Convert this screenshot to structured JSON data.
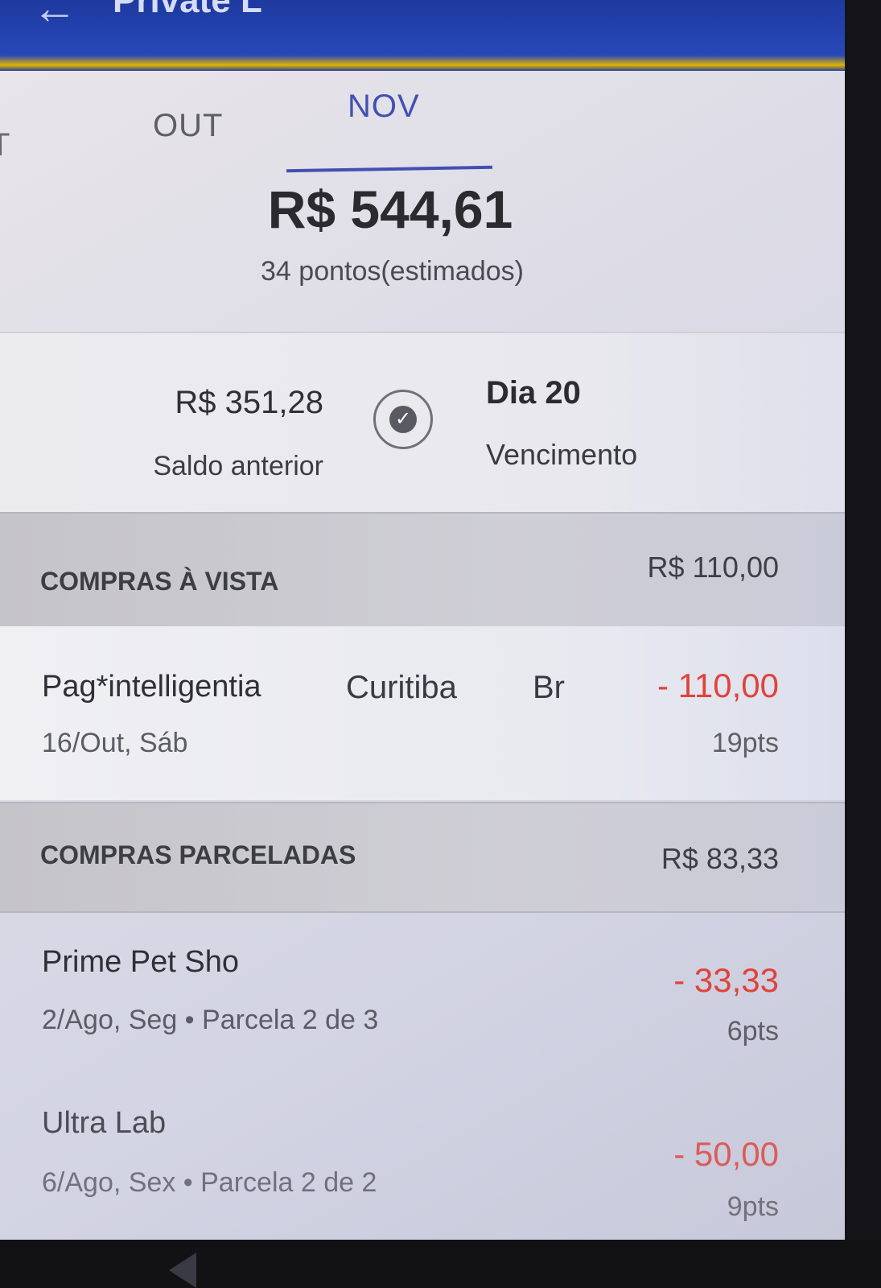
{
  "appbar": {
    "back_icon": "arrow-left-icon",
    "title": "Private L"
  },
  "month_tabs": {
    "prev_partial": "T",
    "previous": "OUT",
    "current": "NOV",
    "active_color": "#4150b2"
  },
  "invoice": {
    "total": "R$ 544,61",
    "points_estimate": "34 pontos(estimados)"
  },
  "summary": {
    "previous_balance_value": "R$ 351,28",
    "previous_balance_label": "Saldo anterior",
    "status_icon": "check-circle-icon",
    "due_day": "Dia 20",
    "due_label": "Vencimento"
  },
  "sections": [
    {
      "title": "COMPRAS À VISTA",
      "total": "R$ 110,00",
      "transactions": [
        {
          "merchant": "Pag*intelligentia",
          "city": "Curitiba",
          "country": "Br",
          "date": "16/Out, Sáb",
          "amount": "- 110,00",
          "points": "19pts"
        }
      ]
    },
    {
      "title": "COMPRAS PARCELADAS",
      "total": "R$ 83,33",
      "transactions": [
        {
          "merchant": "Prime Pet Sho",
          "date": "2/Ago, Seg  •  Parcela 2 de 3",
          "amount": "- 33,33",
          "points": "6pts"
        },
        {
          "merchant": "Ultra Lab",
          "date": "6/Ago, Sex  •  Parcela 2 de 2",
          "amount": "- 50,00",
          "points": "9pts"
        }
      ]
    }
  ],
  "colors": {
    "appbar": "#2748b8",
    "appbar_accent": "#e0b400",
    "debit_amount": "#e0433c"
  },
  "system_nav": {
    "back_icon": "nav-back-icon"
  }
}
